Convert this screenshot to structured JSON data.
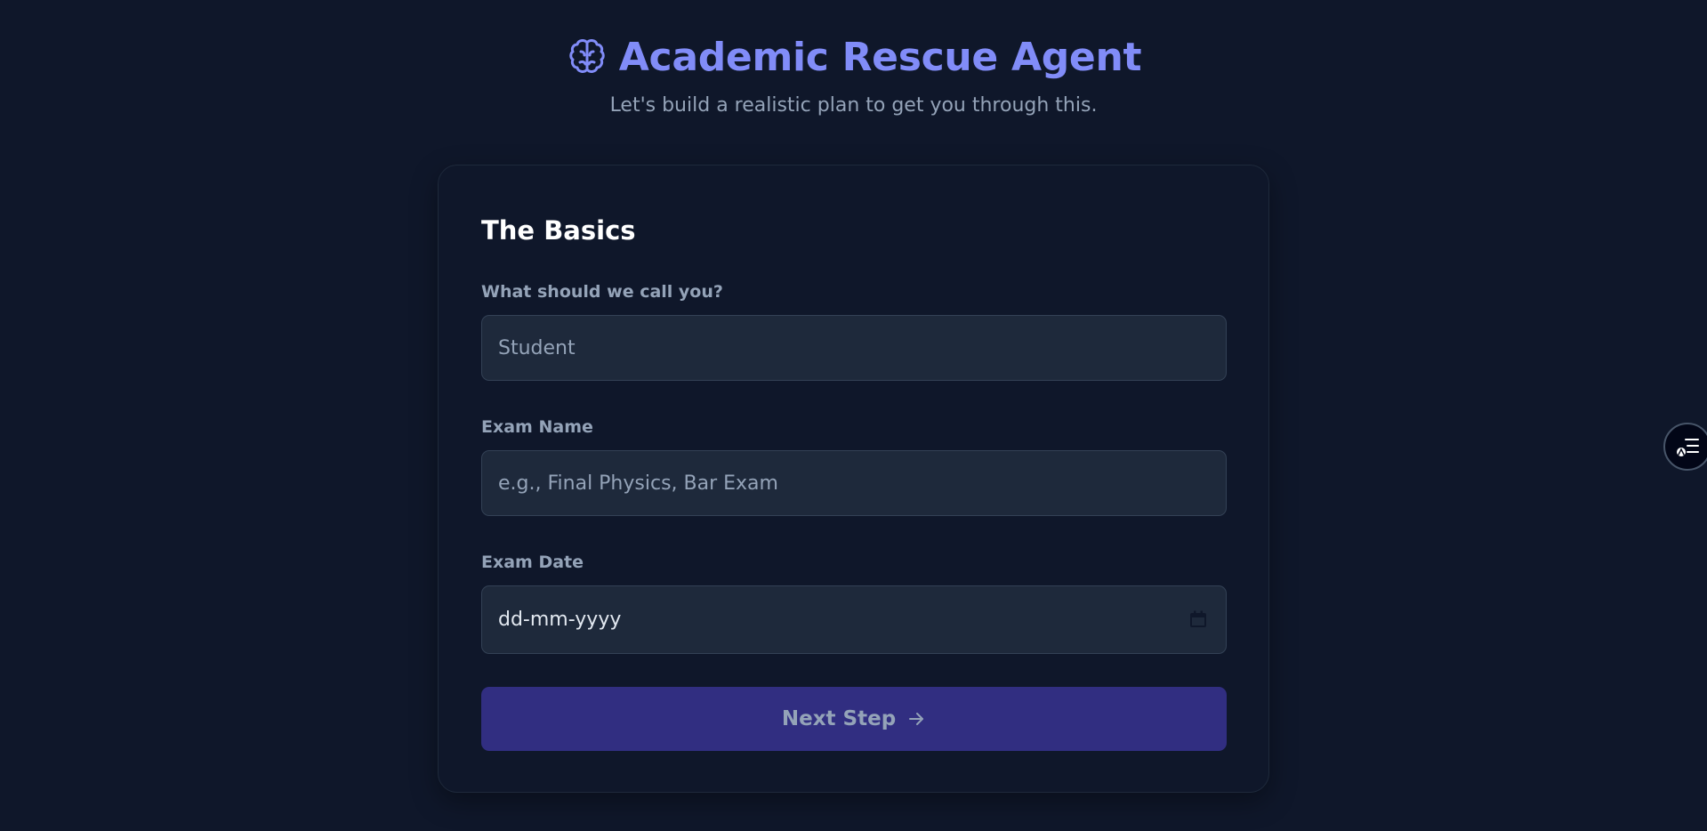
{
  "header": {
    "title": "Academic Rescue Agent",
    "subtitle": "Let's build a realistic plan to get you through this.",
    "icon": "brain-icon",
    "accent_color": "#818cf8"
  },
  "form": {
    "section_title": "The Basics",
    "fields": [
      {
        "label": "What should we call you?",
        "placeholder": "Student"
      },
      {
        "label": "Exam Name",
        "placeholder": "e.g., Final Physics, Bar Exam"
      },
      {
        "label": "Exam Date",
        "placeholder": "dd-mm-yyyy",
        "icon": "calendar-icon"
      }
    ],
    "next_button": {
      "label": "Next Step",
      "icon": "arrow-right-icon",
      "color": "#312e81"
    }
  },
  "side_widget": {
    "icon": "reader-list-icon"
  },
  "colors": {
    "background": "#0f172a",
    "input_background": "#1e293b",
    "muted_text": "#94a3b8"
  }
}
